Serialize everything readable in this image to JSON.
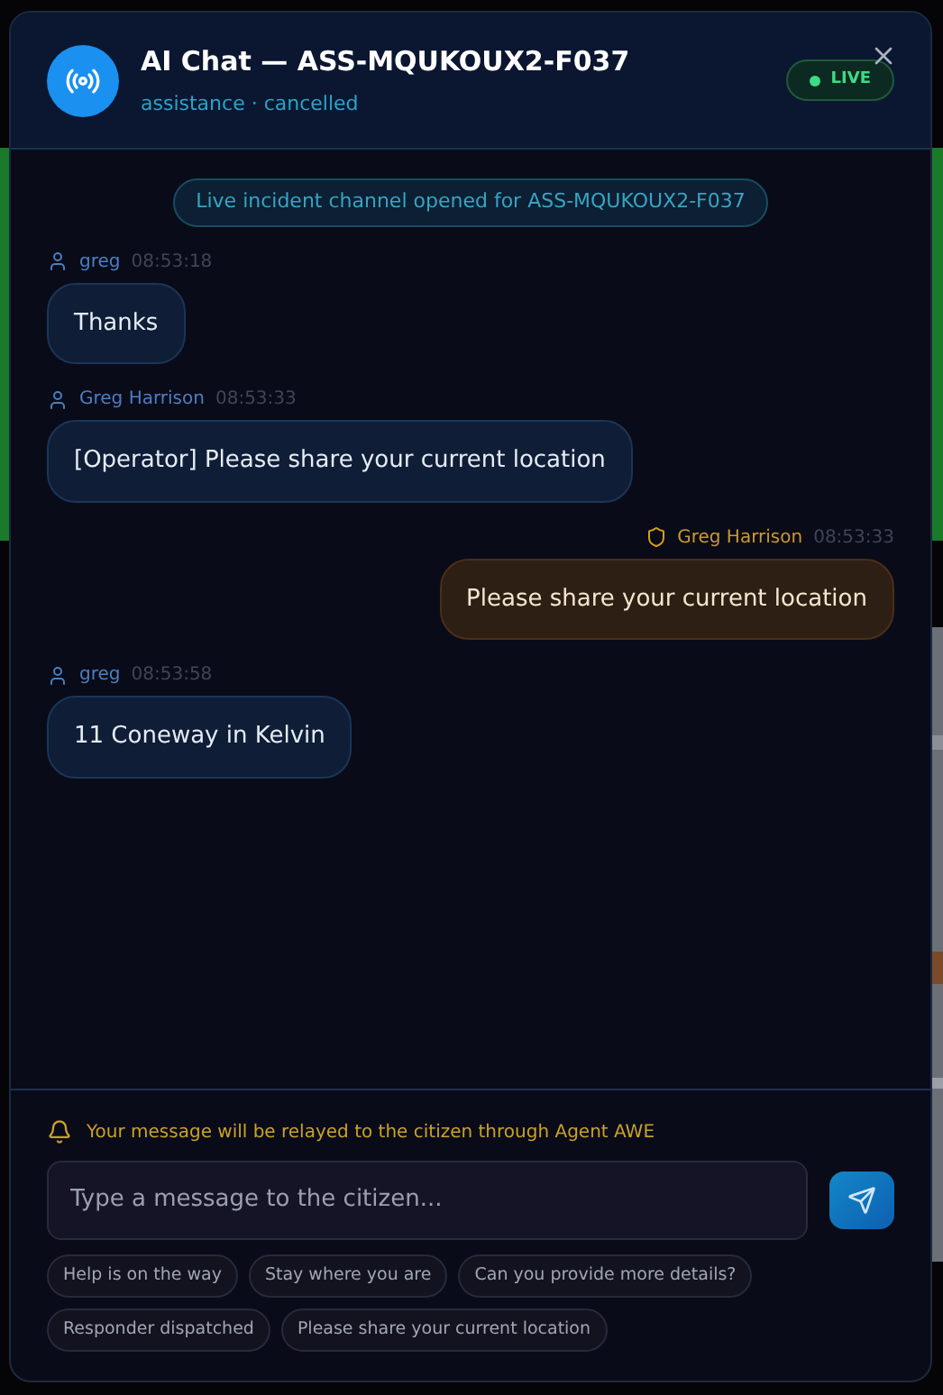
{
  "header": {
    "title": "AI Chat — ASS-MQUKOUX2-F037",
    "subtitle": "assistance · cancelled",
    "status": {
      "label": "LIVE",
      "on": true
    }
  },
  "messages": [
    {
      "kind": "notice",
      "text": "Live incident channel opened for ASS-MQUKOUX2-F037"
    },
    {
      "kind": "incoming",
      "sender": "greg",
      "time": "08:53:18",
      "text": "Thanks"
    },
    {
      "kind": "incoming",
      "sender": "Greg Harrison",
      "time": "08:53:33",
      "text": "[Operator] Please share your current location"
    },
    {
      "kind": "outgoing",
      "sender": "Greg Harrison",
      "time": "08:53:33",
      "text": "Please share your current location"
    },
    {
      "kind": "incoming",
      "sender": "greg",
      "time": "08:53:58",
      "text": "11 Coneway in Kelvin"
    }
  ],
  "composer": {
    "hint": "Your message will be relayed to the citizen through Agent AWE",
    "placeholder": "Type a message to the citizen..."
  },
  "quick_replies": [
    "Help is on the way",
    "Stay where you are",
    "Can you provide more details?",
    "Responder dispatched",
    "Please share your current location"
  ]
}
